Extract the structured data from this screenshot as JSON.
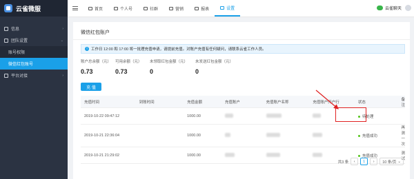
{
  "app": {
    "name": "云雀微服"
  },
  "sidebar": {
    "items": [
      {
        "label": "信息"
      },
      {
        "label": "团队设置"
      },
      {
        "label": "账号权限"
      },
      {
        "label": "微信红包账号"
      },
      {
        "label": "平台对接"
      }
    ]
  },
  "topbar": {
    "tabs": [
      {
        "label": "首页"
      },
      {
        "label": "个人号"
      },
      {
        "label": "社群"
      },
      {
        "label": "营销"
      },
      {
        "label": "报表"
      },
      {
        "label": "设置"
      }
    ],
    "status": "云雀聊天"
  },
  "page": {
    "title": "微信红包账户",
    "notice": "工作日 12:00 和 17:00 将一批理充值申请，请提前充值。对账户充值有任何疑问，请联系云雀工作人员。"
  },
  "stats": [
    {
      "label": "账户总余额（元）",
      "value": "0.73"
    },
    {
      "label": "可用余额（元）",
      "value": "0.73"
    },
    {
      "label": "未领取红包金额（元）",
      "value": "0"
    },
    {
      "label": "未发送红包金额（元）",
      "value": "0"
    }
  ],
  "recharge_button": "充 值",
  "table": {
    "columns": [
      "充值时间",
      "到账时间",
      "充值金额",
      "充值账户",
      "充值账户名称",
      "充值账户开户行",
      "状态",
      "备注"
    ],
    "rows": [
      {
        "time": "2019-10-22 09:47:12",
        "arrival": "",
        "amount": "1000.00",
        "status": "待处理",
        "note": ""
      },
      {
        "time": "2019-10-21 22:36:04",
        "arrival": "",
        "amount": "1000.00",
        "status": "充值成功",
        "note": "再测一次"
      },
      {
        "time": "2019-10-21 21:29:02",
        "arrival": "",
        "amount": "1000.00",
        "status": "充值成功",
        "note": "测试"
      }
    ]
  },
  "pagination": {
    "total": "共3 条",
    "current": "1",
    "page_size": "10 条/页"
  },
  "colors": {
    "accent": "#1aa0e8",
    "sidebar": "#2b3342",
    "success": "#52c41a",
    "highlight": "#e02020"
  }
}
